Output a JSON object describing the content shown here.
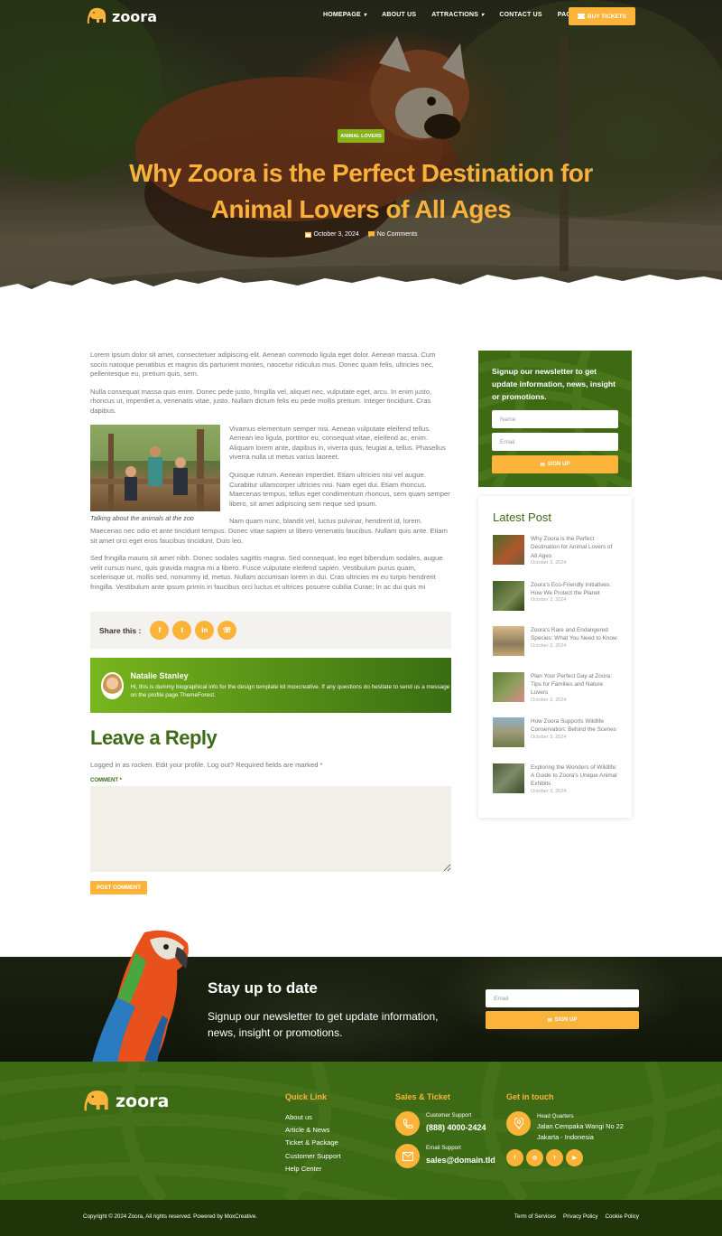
{
  "brand": {
    "name": "zoora"
  },
  "nav": {
    "items": [
      {
        "label": "HOMEPAGE",
        "dropdown": true
      },
      {
        "label": "ABOUT US",
        "dropdown": false
      },
      {
        "label": "ATTRACTIONS",
        "dropdown": true
      },
      {
        "label": "CONTACT US",
        "dropdown": false
      },
      {
        "label": "PAGES",
        "dropdown": true
      }
    ],
    "buy_label": "BUY TICKETS"
  },
  "hero": {
    "tag": "ANIMAL LOVERS",
    "title": "Why Zoora is the Perfect Destination for Animal Lovers of All Ages",
    "date": "October 3, 2024",
    "comments": "No Comments"
  },
  "article": {
    "p1": "Lorem ipsum dolor sit amet, consectetuer adipiscing elit. Aenean commodo ligula eget dolor. Aenean massa. Cum sociis natoque penatibus et magnis dis parturient montes, nascetur ridiculus mus. Donec quam felis, ultricies nec, pellentesque eu, pretium quis, sem.",
    "p2": "Nulla consequat massa quis enim. Donec pede justo, fringilla vel, aliquet nec, vulputate eget, arcu. In enim justo, rhoncus ut, imperdiet a, venenatis vitae, justo. Nullam dictum felis eu pede mollis pretium. Integer tincidunt. Cras dapibus.",
    "p3": "Vivamus elementum semper nisi. Aenean vulputate eleifend tellus. Aenean leo ligula, porttitor eu, consequat vitae, eleifend ac, enim. Aliquam lorem ante, dapibus in, viverra quis, feugiat a, tellus. Phasellus viverra nulla ut metus varius laoreet.",
    "p4": "Quisque rutrum. Aenean imperdiet. Etiam ultricies nisi vel augue. Curabitur ullamcorper ultricies nisi. Nam eget dui. Etiam rhoncus. Maecenas tempus, tellus eget condimentum rhoncus, sem quam semper libero, sit amet adipiscing sem neque sed ipsum.",
    "p5": "Nam quam nunc, blandit vel, luctus pulvinar, hendrerit id, lorem. Maecenas nec odio et ante tincidunt tempus. Donec vitae sapien ut libero venenatis faucibus. Nullam quis ante. Etiam sit amet orci eget eros faucibus tincidunt. Duis leo.",
    "p6": "Sed fringilla mauris sit amet nibh. Donec sodales sagittis magna. Sed consequat, leo eget bibendum sodales, augue velit cursus nunc, quis gravida magna mi a libero. Fusce vulputate eleifend sapien. Vestibulum purus quam, scelerisque ut, mollis sed, nonummy id, metus. Nullam accumsan lorem in dui. Cras ultricies mi eu turpis hendrerit fringilla. Vestibulum ante ipsum primis in faucibus orci luctus et ultrices posuere cubilia Curae; In ac dui quis mi",
    "caption": "Talking about the animals at the zoo"
  },
  "share": {
    "label": "Share this :",
    "icons": [
      "facebook-icon",
      "twitter-icon",
      "linkedin-icon",
      "whatsapp-icon"
    ]
  },
  "author": {
    "name": "Natalie Stanley",
    "bio": "Hi, this is dummy biographical info for the design template kit moxcreative. If any questions do hesitate to send us a message on the profile page ThemeForest."
  },
  "reply": {
    "title": "Leave a Reply",
    "logged_in": "Logged in as rocken. Edit your profile. Log out? Required fields are marked *",
    "comment_label": "COMMENT *",
    "submit": "POST COMMENT"
  },
  "sidebar": {
    "newsletter": {
      "title": "Signup our newsletter to get update information, news, insight or promotions.",
      "name_placeholder": "Name",
      "email_placeholder": "Email",
      "button": "SIGN UP"
    },
    "latest_title": "Latest Post",
    "posts": [
      {
        "title": "Why Zoora is the Perfect Destination for Animal Lovers of All Ages",
        "date": "October 3, 2024"
      },
      {
        "title": "Zoora's Eco-Friendly Initiatives: How We Protect the Planet",
        "date": "October 3, 2024"
      },
      {
        "title": "Zoora's Rare and Endangered Species: What You Need to Know",
        "date": "October 3, 2024"
      },
      {
        "title": "Plan Your Perfect Day at Zoora: Tips for Families and Nature Lovers",
        "date": "October 3, 2024"
      },
      {
        "title": "How Zoora Supports Wildlife Conservation: Behind the Scenes",
        "date": "October 3, 2024"
      },
      {
        "title": "Exploring the Wonders of Wildlife: A Guide to Zoora's Unique Animal Exhibits",
        "date": "October 3, 2024"
      }
    ]
  },
  "band": {
    "title": "Stay up to date",
    "text": "Signup our newsletter to get update information, news, insight or promotions.",
    "email_placeholder": "Email",
    "button": "SIGN UP"
  },
  "footer": {
    "quick_title": "Quick Link",
    "quick_links": [
      "About us",
      "Article & News",
      "Ticket & Package",
      "Customer Support",
      "Help Center"
    ],
    "sales_title": "Sales & Ticket",
    "support_label": "Customer Support",
    "support_value": "(888) 4000-2424",
    "email_label": "Email Support",
    "email_value": "sales@domain.tld",
    "touch_title": "Get in touch",
    "hq_label": "Head Quarters",
    "hq_line1": "Jalan Cempaka Wangi No 22",
    "hq_line2": "Jakarta - Indonesia",
    "socials": [
      "facebook-icon",
      "instagram-icon",
      "twitter-icon",
      "youtube-icon"
    ],
    "copyright": "Copyright © 2024 Zoora, All rights reserved. Powered by MoxCreative.",
    "legal": [
      "Term of Services",
      "Privacy Policy",
      "Cookie Policy"
    ]
  },
  "colors": {
    "accent": "#fcb33a",
    "green": "#3d6a15",
    "lime": "#86b31b"
  }
}
